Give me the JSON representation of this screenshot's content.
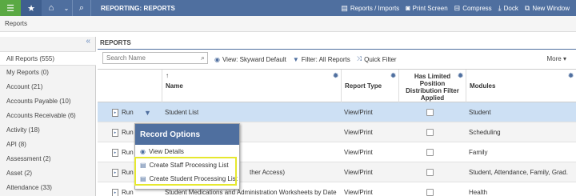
{
  "topbar": {
    "title": "REPORTING: REPORTS",
    "actions": [
      {
        "icon": "reports-imports-icon",
        "label": "Reports / Imports"
      },
      {
        "icon": "camera-icon",
        "label": "Print Screen"
      },
      {
        "icon": "compress-icon",
        "label": "Compress"
      },
      {
        "icon": "dock-icon",
        "label": "Dock"
      },
      {
        "icon": "new-window-icon",
        "label": "New Window"
      }
    ],
    "colors": {
      "bar": "#4f6f9f",
      "menu_green": "#5aa943"
    }
  },
  "breadcrumb": "Reports",
  "sidebar": {
    "items": [
      {
        "label": "All Reports (555)",
        "active": true
      },
      {
        "label": "My Reports (0)"
      },
      {
        "label": "Account (21)"
      },
      {
        "label": "Accounts Payable (10)"
      },
      {
        "label": "Accounts Receivable (6)"
      },
      {
        "label": "Activity (18)"
      },
      {
        "label": "API (8)"
      },
      {
        "label": "Assessment (2)"
      },
      {
        "label": "Asset (2)"
      },
      {
        "label": "Attendance (33)"
      }
    ]
  },
  "main": {
    "title": "REPORTS",
    "search_placeholder": "Search Name",
    "view_label": "View: Skyward Default",
    "filter_label": "Filter: All Reports",
    "quick_filter_label": "Quick Filter",
    "more_label": "More"
  },
  "table": {
    "columns": [
      "Name",
      "Report Type",
      "Has Limited Position Distribution Filter Applied",
      "Modules"
    ],
    "run_label": "Run",
    "rows": [
      {
        "name": "Student List",
        "type": "View/Print",
        "modules": "Student"
      },
      {
        "name": "",
        "type": "View/Print",
        "modules": "Scheduling"
      },
      {
        "name": "",
        "type": "View/Print",
        "modules": "Family"
      },
      {
        "name": "ther Access)",
        "type": "View/Print",
        "modules": "Student, Attendance, Family, Grad."
      },
      {
        "name": "Student Medications and Administration Worksheets by Date",
        "type": "View/Print",
        "modules": "Health"
      }
    ]
  },
  "popup": {
    "title": "Record Options",
    "items": [
      {
        "label": "View Details"
      },
      {
        "label": "Create Staff Processing List"
      },
      {
        "label": "Create Student Processing List"
      }
    ]
  }
}
